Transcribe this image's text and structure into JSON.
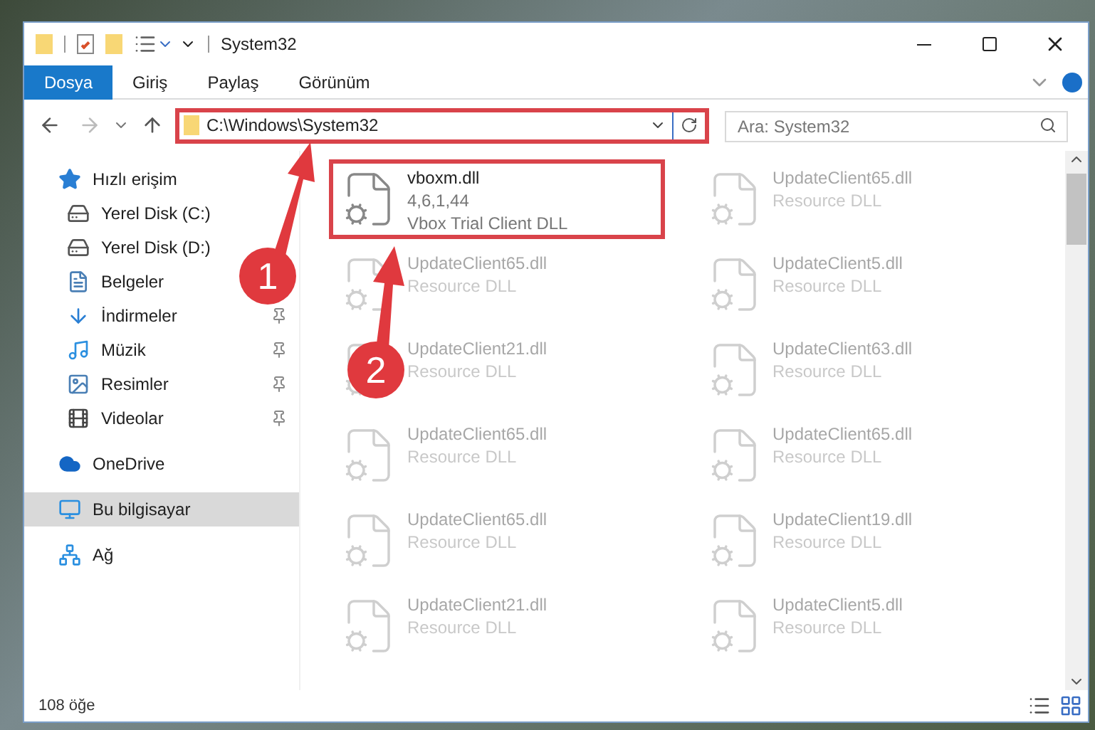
{
  "window": {
    "title": "System32"
  },
  "ribbon_tabs": [
    {
      "label": "Dosya",
      "selected": true
    },
    {
      "label": "Giriş",
      "selected": false
    },
    {
      "label": "Paylaş",
      "selected": false
    },
    {
      "label": "Görünüm",
      "selected": false
    }
  ],
  "address_bar": {
    "path": "C:\\Windows\\System32",
    "highlighted": true
  },
  "search": {
    "placeholder": "Ara: System32"
  },
  "sidebar": {
    "items": [
      {
        "label": "Hızlı erişim",
        "selected": false,
        "children": [
          {
            "label": "Yerel Disk (C:)",
            "pinned": false,
            "selected": false
          },
          {
            "label": "Yerel Disk (D:)",
            "pinned": false,
            "selected": false
          },
          {
            "label": "Belgeler",
            "pinned": false,
            "selected": false
          },
          {
            "label": "İndirmeler",
            "pinned": true,
            "selected": false
          },
          {
            "label": "Müzik",
            "pinned": true,
            "selected": false
          },
          {
            "label": "Resimler",
            "pinned": true,
            "selected": false
          },
          {
            "label": "Videolar",
            "pinned": true,
            "selected": false
          }
        ]
      },
      {
        "label": "OneDrive",
        "selected": false
      },
      {
        "label": "Bu bilgisayar",
        "selected": true
      },
      {
        "label": "Ağ",
        "selected": false
      }
    ]
  },
  "files": [
    {
      "name": "vboxm.dll",
      "version": "4,6,1,44",
      "description": "Vbox Trial Client DLL",
      "highlighted": true,
      "faded": false
    },
    {
      "name": "UpdateClient65.dll",
      "description": "Resource DLL",
      "highlighted": false,
      "faded": true
    },
    {
      "name": "UpdateClient65.dll",
      "description": "Resource DLL",
      "highlighted": false,
      "faded": true
    },
    {
      "name": "UpdateClient5.dll",
      "description": "Resource DLL",
      "highlighted": false,
      "faded": true
    },
    {
      "name": "UpdateClient21.dll",
      "description": "Resource DLL",
      "highlighted": false,
      "faded": true
    },
    {
      "name": "UpdateClient63.dll",
      "description": "Resource DLL",
      "highlighted": false,
      "faded": true
    },
    {
      "name": "UpdateClient65.dll",
      "description": "Resource DLL",
      "highlighted": false,
      "faded": true
    },
    {
      "name": "UpdateClient65.dll",
      "description": "Resource DLL",
      "highlighted": false,
      "faded": true
    },
    {
      "name": "UpdateClient65.dll",
      "description": "Resource DLL",
      "highlighted": false,
      "faded": true
    },
    {
      "name": "UpdateClient19.dll",
      "description": "Resource DLL",
      "highlighted": false,
      "faded": true
    },
    {
      "name": "UpdateClient21.dll",
      "description": "Resource DLL",
      "highlighted": false,
      "faded": true
    },
    {
      "name": "UpdateClient5.dll",
      "description": "Resource DLL",
      "highlighted": false,
      "faded": true
    }
  ],
  "status_bar": {
    "item_count": "108 öğe"
  },
  "annotations": [
    {
      "label": "1"
    },
    {
      "label": "2"
    }
  ]
}
